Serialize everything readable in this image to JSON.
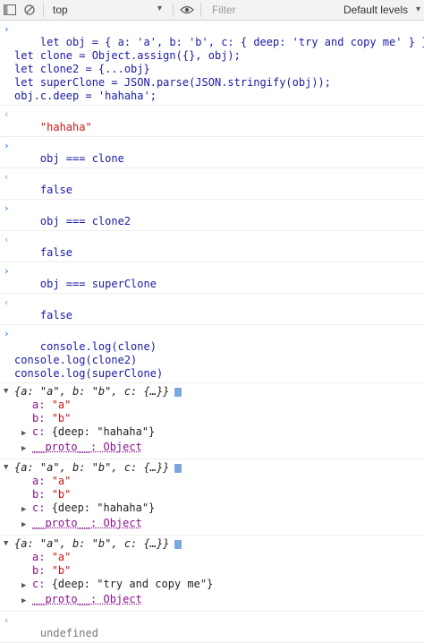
{
  "toolbar": {
    "context_label": "top",
    "filter_placeholder": "Filter",
    "levels_label": "Default levels"
  },
  "commands": [
    {
      "lines": [
        "let obj = { a: 'a', b: 'b', c: { deep: 'try and copy me' } };",
        "let clone = Object.assign({}, obj);",
        "let clone2 = {...obj}",
        "let superClone = JSON.parse(JSON.stringify(obj));",
        "obj.c.deep = 'hahaha';"
      ],
      "result": "\"hahaha\""
    },
    {
      "lines": [
        "obj === clone"
      ],
      "result": "false"
    },
    {
      "lines": [
        "obj === clone2"
      ],
      "result": "false"
    },
    {
      "lines": [
        "obj === superClone"
      ],
      "result": "false"
    },
    {
      "lines": [
        "console.log(clone)",
        "console.log(clone2)",
        "console.log(superClone)"
      ]
    }
  ],
  "logs": [
    {
      "summary": "{a: \"a\", b: \"b\", c: {…}}",
      "a": "\"a\"",
      "b": "\"b\"",
      "c": "{deep: \"hahaha\"}",
      "proto": "__proto__: Object"
    },
    {
      "summary": "{a: \"a\", b: \"b\", c: {…}}",
      "a": "\"a\"",
      "b": "\"b\"",
      "c": "{deep: \"hahaha\"}",
      "proto": "__proto__: Object"
    },
    {
      "summary": "{a: \"a\", b: \"b\", c: {…}}",
      "a": "\"a\"",
      "b": "\"b\"",
      "c": "{deep: \"try and copy me\"}",
      "proto": "__proto__: Object"
    }
  ],
  "final_result": "undefined",
  "labels": {
    "a_key": "a: ",
    "b_key": "b: ",
    "c_key": "c: "
  }
}
